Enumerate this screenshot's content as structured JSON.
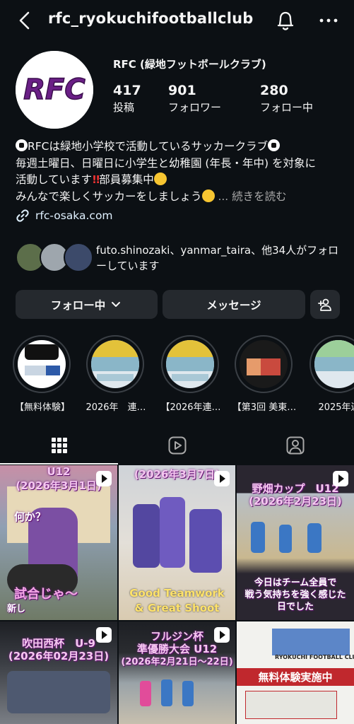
{
  "header": {
    "username": "rfc_ryokuchifootballclub"
  },
  "profile": {
    "avatar_text": "RFC",
    "display_name": "RFC (緑地フットボールクラブ)",
    "stats": [
      {
        "value": "417",
        "label": "投稿"
      },
      {
        "value": "901",
        "label": "フォロワー"
      },
      {
        "value": "280",
        "label": "フォロー中"
      }
    ],
    "bio": {
      "line1": "RFCは緑地小学校で活動しているサッカークラブ",
      "line2": "毎週土曜日、日曜日に小学生と幼稚園 (年長・年中) を対象に",
      "line3a": "活動しています",
      "line3b": "部員募集中",
      "line4": "みんなで楽しくサッカーをしましょう",
      "more": "... 続きを読む"
    },
    "link": "rfc-osaka.com",
    "followed_by": "futo.shinozaki、yanmar_taira、他34人がフォローしています"
  },
  "actions": {
    "following": "フォロー中",
    "message": "メッセージ"
  },
  "highlights": [
    {
      "label": "【無料体験】"
    },
    {
      "label": "2026年　連…"
    },
    {
      "label": "【2026年連…"
    },
    {
      "label": "【第3回 美東…"
    },
    {
      "label": "2025年連"
    }
  ],
  "posts": [
    {
      "title1": "U12",
      "title2": "(2026年3月1日)",
      "caption": "何か？",
      "footer": "試合じゃ〜",
      "footer_small": "新し"
    },
    {
      "title1": "(2026年3月7日)",
      "footer": "Good Teamwork",
      "footer2": "& Great Shoot"
    },
    {
      "title1": "野畑カップ　U12",
      "title2": "(2026年2月23日)",
      "footer": "今日はチーム全員で",
      "footer2": "戦う気持ちを強く感じた",
      "footer3": "日でした"
    },
    {
      "title1": "吹田西杯　U-9",
      "title2": "(2026年02月23日)"
    },
    {
      "title1": "フルジン杯",
      "title2": "準優勝大会 U12",
      "title3": "(2026年2月21日〜22日)"
    },
    {
      "title1": "RYOKUCHI FOOTBALL CLUB",
      "title2": "無料体験実施中"
    }
  ],
  "colors": {
    "background": "#0c1014",
    "button": "#25292e",
    "link": "#e0f1ff",
    "secondary_text": "#a8a8a8"
  }
}
